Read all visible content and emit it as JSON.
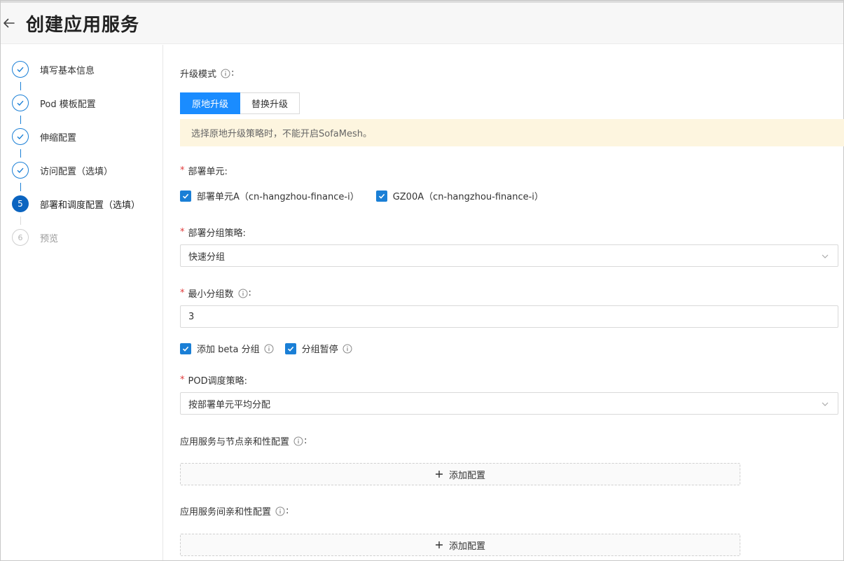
{
  "header": {
    "title": "创建应用服务"
  },
  "steps": [
    {
      "label": "填写基本信息",
      "state": "done"
    },
    {
      "label": "Pod 模板配置",
      "state": "done"
    },
    {
      "label": "伸缩配置",
      "state": "done"
    },
    {
      "label": "访问配置（选填）",
      "state": "done"
    },
    {
      "number": "5",
      "label": "部署和调度配置（选填）",
      "state": "active"
    },
    {
      "number": "6",
      "label": "预览",
      "state": "pending"
    }
  ],
  "upgrade_mode": {
    "label": "升级模式",
    "colon": ":",
    "options": [
      "原地升级",
      "替换升级"
    ],
    "selected": "原地升级",
    "notice": "选择原地升级策略时，不能开启SofaMesh。"
  },
  "deploy_unit": {
    "required_mark": "*",
    "label": "部署单元:",
    "options": [
      {
        "label": "部署单元A（cn-hangzhou-finance-i）",
        "checked": true
      },
      {
        "label": "GZ00A（cn-hangzhou-finance-i）",
        "checked": true
      }
    ]
  },
  "group_strategy": {
    "required_mark": "*",
    "label": "部署分组策略:",
    "value": "快速分组"
  },
  "min_groups": {
    "required_mark": "*",
    "label": "最小分组数",
    "colon": ":",
    "value": "3"
  },
  "group_options": [
    {
      "label": "添加 beta 分组",
      "checked": true
    },
    {
      "label": "分组暂停",
      "checked": true
    }
  ],
  "pod_strategy": {
    "required_mark": "*",
    "label": "POD调度策略:",
    "value": "按部署单元平均分配"
  },
  "node_affinity": {
    "label": "应用服务与节点亲和性配置",
    "colon": ":",
    "add_label": "添加配置"
  },
  "service_affinity": {
    "label": "应用服务间亲和性配置",
    "colon": ":",
    "add_label": "添加配置"
  },
  "colors": {
    "primary": "#1a8cff",
    "step_active": "#0b64c0",
    "notice_bg": "#fdf5df",
    "required": "#e03b3b"
  }
}
